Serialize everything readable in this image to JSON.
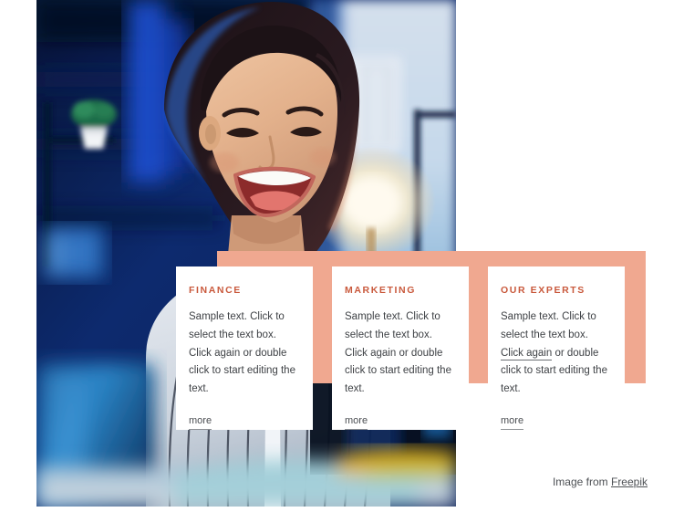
{
  "hero": {
    "image_alt": "Smiling young woman in a striped shirt at a desk in a blue-lit modern office",
    "image_colors": {
      "background_blue": "#102a6b",
      "deep_navy": "#071436",
      "skin": "#e8b997",
      "shirt_light": "#d8dde4",
      "mug_blue": "#1f6fb8",
      "lamp_glow": "#fdf6e4"
    }
  },
  "panel": {
    "accent_color": "#f0a890"
  },
  "theme": {
    "heading_color": "#c9593c",
    "body_color": "#3f4246",
    "card_background": "#ffffff",
    "page_background": "#ffffff"
  },
  "cards": [
    {
      "title": "FINANCE",
      "text_before": "Sample text. Click to select the text box. ",
      "link_text": "",
      "text_after": "Click again or double click to start editing the text.",
      "more_label": "more"
    },
    {
      "title": "MARKETING",
      "text_before": "Sample text. Click to select the text box. ",
      "link_text": "",
      "text_after": "Click again or double click to start editing the text.",
      "more_label": "more"
    },
    {
      "title": "OUR EXPERTS",
      "text_before": "Sample text. Click to select the text box. ",
      "link_text": "Click again",
      "text_after": " or double click to start editing the text.",
      "more_label": "more"
    }
  ],
  "attribution": {
    "prefix": "Image from ",
    "link_label": "Freepik"
  }
}
